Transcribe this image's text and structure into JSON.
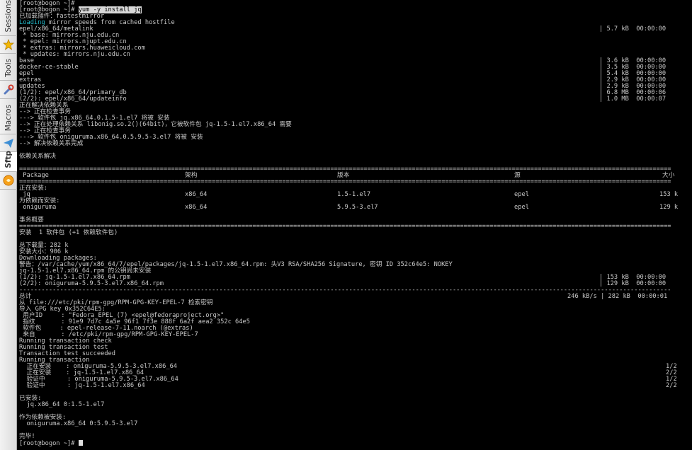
{
  "sidebar": {
    "tabs": [
      {
        "label": "Sessions",
        "icon": "star-icon"
      },
      {
        "label": "Tools",
        "icon": "wrench-icon"
      },
      {
        "label": "Macros",
        "icon": "paper-plane-icon"
      },
      {
        "label": "Sftp",
        "icon": "orange-circle-icon"
      }
    ]
  },
  "terminal": {
    "prompt1": "[root@bogon ~]#",
    "prompt2": "[root@bogon ~]#",
    "command": "yum -y install jq",
    "lines": {
      "plugin": "已加载插件：fastestmirror",
      "loading_word": "Loading",
      "loading_rest": " mirror speeds from cached hostfile",
      "metalink": "epel/x86_64/metalink",
      "metalink_stat": "| 5.7 kB  00:00:00",
      "base_mirror": " * base: mirrors.nju.edu.cn",
      "epel_mirror": " * epel: mirrors.njupt.edu.cn",
      "extras_mirror": " * extras: mirrors.huaweicloud.com",
      "updates_mirror": " * updates: mirrors.nju.edu.cn",
      "repos": [
        {
          "name": "base",
          "stat": "| 3.6 kB  00:00:00"
        },
        {
          "name": "docker-ce-stable",
          "stat": "| 3.5 kB  00:00:00"
        },
        {
          "name": "epel",
          "stat": "| 5.4 kB  00:00:00"
        },
        {
          "name": "extras",
          "stat": "| 2.9 kB  00:00:00"
        },
        {
          "name": "updates",
          "stat": "| 2.9 kB  00:00:00"
        },
        {
          "name": "(1/2): epel/x86_64/primary_db",
          "stat": "| 6.8 MB  00:00:06"
        },
        {
          "name": "(2/2): epel/x86_64/updateinfo",
          "stat": "| 1.0 MB  00:00:07"
        }
      ],
      "resolving": "正在解决依赖关系",
      "checking1": "--> 正在检查事务",
      "pkg_jq": "---> 软件包 jq.x86_64.0.1.5-1.el7 将被 安装",
      "dep_processing": "--> 正在处理依赖关系 libonig.so.2()(64bit)，它被软件包 jq-1.5-1.el7.x86_64 需要",
      "checking2": "--> 正在检查事务",
      "pkg_onig": "---> 软件包 oniguruma.x86_64.0.5.9.5-3.el7 将被 安装",
      "resolved": "--> 解决依赖关系完成",
      "dep_resolved": "依赖关系解决",
      "separator": "================================================================================================================================================================================",
      "dash_separator": "--------------------------------------------------------------------------------------------------------------------------------------------------------------------------------",
      "col_package": " Package",
      "col_arch": "架构",
      "col_version": "版本",
      "col_repo": "源",
      "col_size": "大小",
      "installing": "正在安装:",
      "row_jq": {
        "name": " jq",
        "arch": "x86_64",
        "version": "1.5-1.el7",
        "repo": "epel",
        "size": "153 k"
      },
      "for_deps": "为依赖而安装:",
      "row_onig": {
        "name": " oniguruma",
        "arch": "x86_64",
        "version": "5.9.5-3.el7",
        "repo": "epel",
        "size": "129 k"
      },
      "summary": "事务概要",
      "install_count": "安装  1 软件包 (+1 依赖软件包)",
      "total_download": "总下载量：282 k",
      "installed_size": "安装大小：906 k",
      "downloading": "Downloading packages:",
      "warning": "警告：/var/cache/yum/x86_64/7/epel/packages/jq-1.5-1.el7.x86_64.rpm: 头V3 RSA/SHA256 Signature, 密钥 ID 352c64e5: NOKEY",
      "pubkey_missing": "jq-1.5-1.el7.x86_64.rpm 的公钥尚未安装",
      "dl1": "(1/2): jq-1.5-1.el7.x86_64.rpm",
      "dl1_stat": "| 153 kB  00:00:00",
      "dl2": "(2/2): oniguruma-5.9.5-3.el7.x86_64.rpm",
      "dl2_stat": "| 129 kB  00:00:00",
      "total_label": "总计",
      "total_stat": "246 kB/s | 282 kB  00:00:01",
      "retrieve_key": "从 file:///etc/pki/rpm-gpg/RPM-GPG-KEY-EPEL-7 检索密钥",
      "import_key": "导入 GPG key 0x352C64E5:",
      "user_id": " 用户ID     : \"Fedora EPEL (7) <epel@fedoraproject.org>\"",
      "fingerprint": " 指纹       : 91e9 7d7c 4a5e 96f1 7f3e 888f 6a2f aea2 352c 64e5",
      "package": " 软件包     : epel-release-7-11.noarch (@extras)",
      "from": " 来自       : /etc/pki/rpm-gpg/RPM-GPG-KEY-EPEL-7",
      "run_check": "Running transaction check",
      "run_test": "Running transaction test",
      "test_ok": "Transaction test succeeded",
      "running": "Running transaction",
      "steps": [
        {
          "text": "  正在安装    : oniguruma-5.9.5-3.el7.x86_64",
          "n": "1/2"
        },
        {
          "text": "  正在安装    : jq-1.5-1.el7.x86_64",
          "n": "2/2"
        },
        {
          "text": "  验证中      : oniguruma-5.9.5-3.el7.x86_64",
          "n": "1/2"
        },
        {
          "text": "  验证中      : jq-1.5-1.el7.x86_64",
          "n": "2/2"
        }
      ],
      "installed": "已安装:",
      "installed_pkg": "  jq.x86_64 0:1.5-1.el7",
      "dep_installed": "作为依赖被安装:",
      "dep_installed_pkg": "  oniguruma.x86_64 0:5.9.5-3.el7",
      "done": "完毕!"
    }
  },
  "colors": {
    "background": "#000000",
    "text": "#c9c9c9",
    "accent": "#22b8c8",
    "highlight": "#d8d8d8"
  }
}
